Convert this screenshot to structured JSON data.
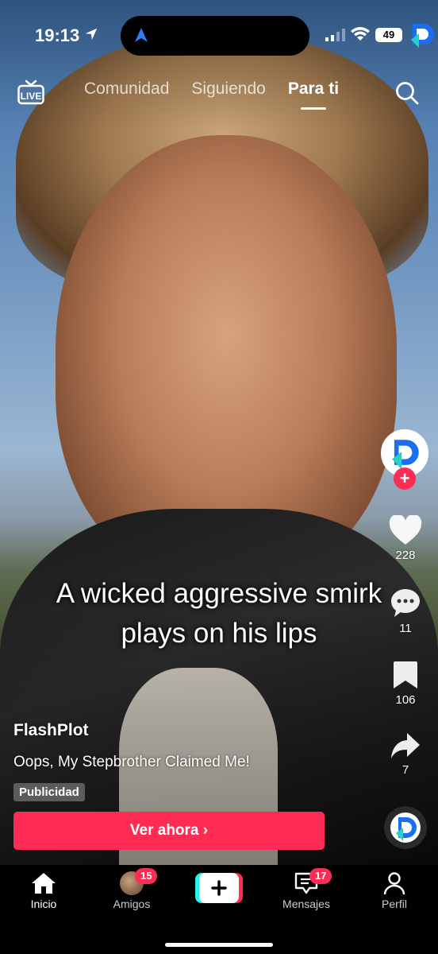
{
  "status_bar": {
    "time": "19:13",
    "battery": "49"
  },
  "top_nav": {
    "tabs": [
      "Comunidad",
      "Siguiendo",
      "Para ti"
    ],
    "active_tab": "Para ti",
    "live_label": "LIVE"
  },
  "video": {
    "caption_line1": "A wicked aggressive smirk",
    "caption_line2": "plays on his lips"
  },
  "right_rail": {
    "likes": "228",
    "comments": "11",
    "saves": "106",
    "shares": "7"
  },
  "ad": {
    "author": "FlashPlot",
    "description": "Oops, My Stepbrother Claimed Me!",
    "badge": "Publicidad",
    "cta": "Ver ahora ›"
  },
  "bottom_nav": {
    "items": [
      {
        "label": "Inicio"
      },
      {
        "label": "Amigos",
        "badge": "15"
      },
      {
        "label": "Mensajes",
        "badge": "17"
      },
      {
        "label": "Perfil"
      }
    ]
  },
  "colors": {
    "accent": "#fe2c55",
    "brand_blue": "#1a6ff0",
    "brand_teal": "#25d0c6"
  }
}
